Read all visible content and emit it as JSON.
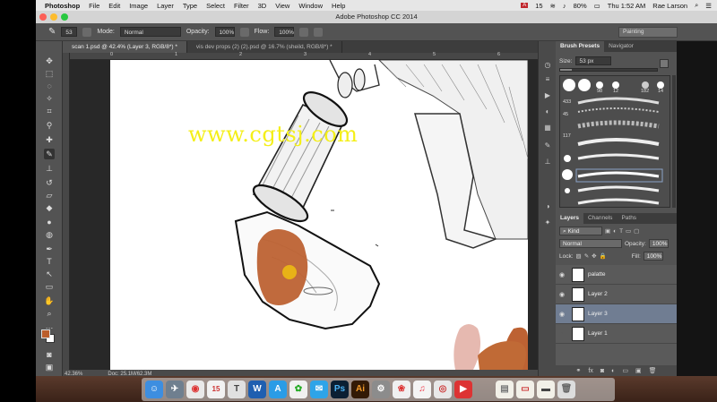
{
  "menubar": {
    "app_name": "Photoshop",
    "items": [
      "File",
      "Edit",
      "Image",
      "Layer",
      "Type",
      "Select",
      "Filter",
      "3D",
      "View",
      "Window",
      "Help"
    ],
    "status_adobe_badge": "15",
    "battery": "80%",
    "clock": "Thu 1:52 AM",
    "user": "Rae Larson"
  },
  "window": {
    "title": "Adobe Photoshop CC 2014"
  },
  "options": {
    "brush_size": "53",
    "mode_label": "Mode:",
    "mode_value": "Normal",
    "opacity_label": "Opacity:",
    "opacity_value": "100%",
    "flow_label": "Flow:",
    "flow_value": "100%",
    "workspace": "Painting"
  },
  "tabs": [
    {
      "label": "scan 1.psd @ 42.4% (Layer 3, RGB/8*) *"
    },
    {
      "label": "vis dev props (2) (2).psd @ 16.7% (sheild, RGB/8*) *"
    }
  ],
  "ruler": {
    "marks": [
      "0",
      "1",
      "2",
      "3",
      "4",
      "5",
      "6",
      "7",
      "8"
    ]
  },
  "status": {
    "zoom": "42.36%",
    "doc": "Doc: 25.1M/62.3M"
  },
  "brush_panel": {
    "tabs": [
      "Brush Presets",
      "Navigator"
    ],
    "size_label": "Size:",
    "size_value": "53 px",
    "size_fraction": 0.12,
    "preset_numbers": [
      "98",
      "12",
      "182",
      "14",
      "433",
      "45",
      "117",
      "19",
      "10"
    ]
  },
  "layers_panel": {
    "tabs": [
      "Layers",
      "Channels",
      "Paths"
    ],
    "filter": "Kind",
    "blend_mode": "Normal",
    "opacity_label": "Opacity:",
    "opacity_value": "100%",
    "lock_label": "Lock:",
    "fill_label": "Fill:",
    "fill_value": "100%",
    "layers": [
      {
        "name": "palatte",
        "visible": true,
        "selected": false
      },
      {
        "name": "Layer 2",
        "visible": true,
        "selected": false
      },
      {
        "name": "Layer 3",
        "visible": true,
        "selected": true
      },
      {
        "name": "Layer 1",
        "visible": false,
        "selected": false
      }
    ]
  },
  "colors": {
    "foreground": "#bb5e2c",
    "background": "#ffffff",
    "selected_layer": "#707d92"
  },
  "watermark": "www.cgtsj.com"
}
